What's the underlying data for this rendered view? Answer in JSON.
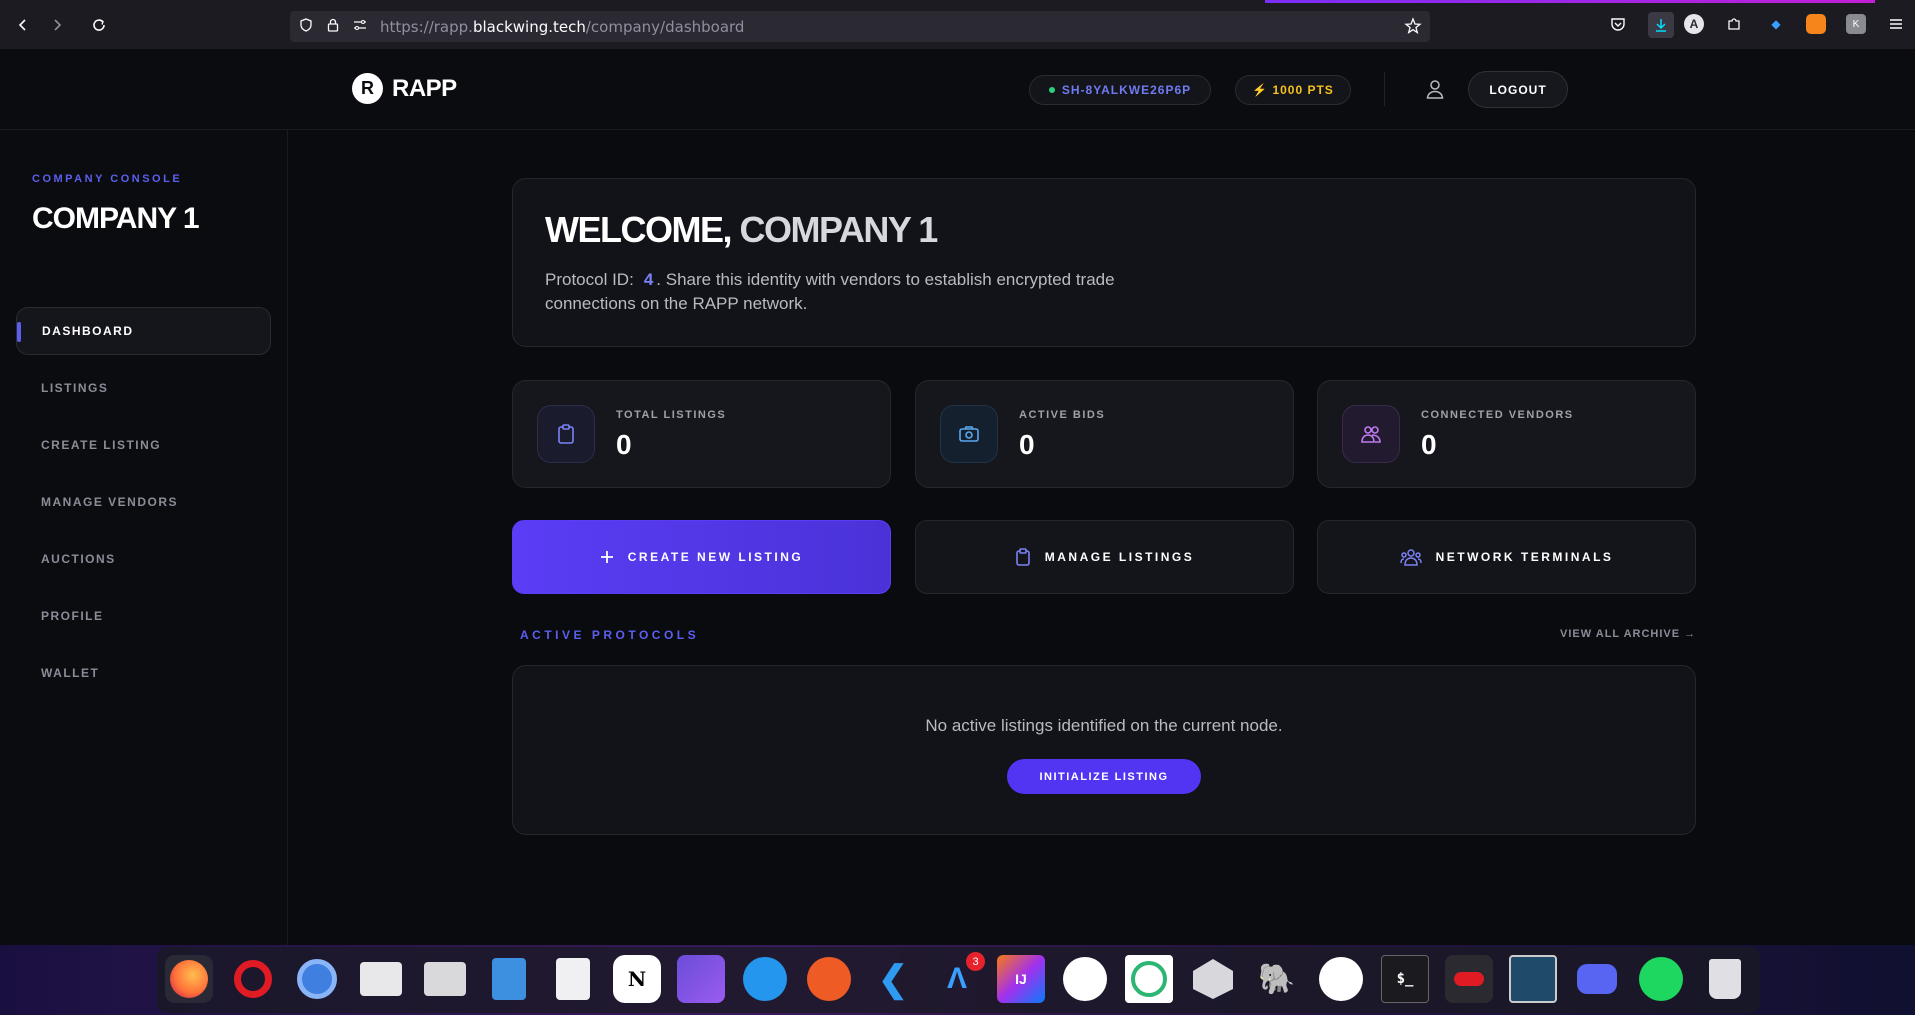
{
  "browser": {
    "url_prefix": "https://rapp.",
    "url_domain": "blackwing.tech",
    "url_path": "/company/dashboard"
  },
  "header": {
    "logo_letter": "R",
    "logo_text": "RAPP",
    "session_id": "SH-8YALKWE26P6P",
    "points": "⚡ 1000 PTS",
    "logout_label": "LOGOUT"
  },
  "sidebar": {
    "console_label": "COMPANY CONSOLE",
    "company_name": "COMPANY 1",
    "items": [
      {
        "label": "DASHBOARD"
      },
      {
        "label": "LISTINGS"
      },
      {
        "label": "CREATE LISTING"
      },
      {
        "label": "MANAGE VENDORS"
      },
      {
        "label": "AUCTIONS"
      },
      {
        "label": "PROFILE"
      },
      {
        "label": "WALLET"
      }
    ]
  },
  "welcome": {
    "greeting": "WELCOME,",
    "name": "COMPANY 1",
    "protocol_prefix": "Protocol ID:",
    "protocol_id": "4",
    "protocol_suffix": ". Share this identity with vendors to establish encrypted trade connections on the RAPP network."
  },
  "stats": [
    {
      "label": "TOTAL LISTINGS",
      "value": "0",
      "icon": "clipboard-icon"
    },
    {
      "label": "ACTIVE BIDS",
      "value": "0",
      "icon": "camera-icon"
    },
    {
      "label": "CONNECTED VENDORS",
      "value": "0",
      "icon": "users-icon"
    }
  ],
  "actions": {
    "create": "CREATE NEW LISTING",
    "manage": "MANAGE LISTINGS",
    "network": "NETWORK TERMINALS"
  },
  "protocols": {
    "section_label": "ACTIVE PROTOCOLS",
    "archive_link": "VIEW ALL ARCHIVE →",
    "empty_message": "No active listings identified on the current node.",
    "init_button": "INITIALIZE LISTING"
  },
  "dock": {
    "badge_count": "3"
  },
  "colors": {
    "accent": "#5b5ff0",
    "primary_button": "#5234f3",
    "points": "#f4c21c",
    "status_dot": "#2ad07a"
  }
}
